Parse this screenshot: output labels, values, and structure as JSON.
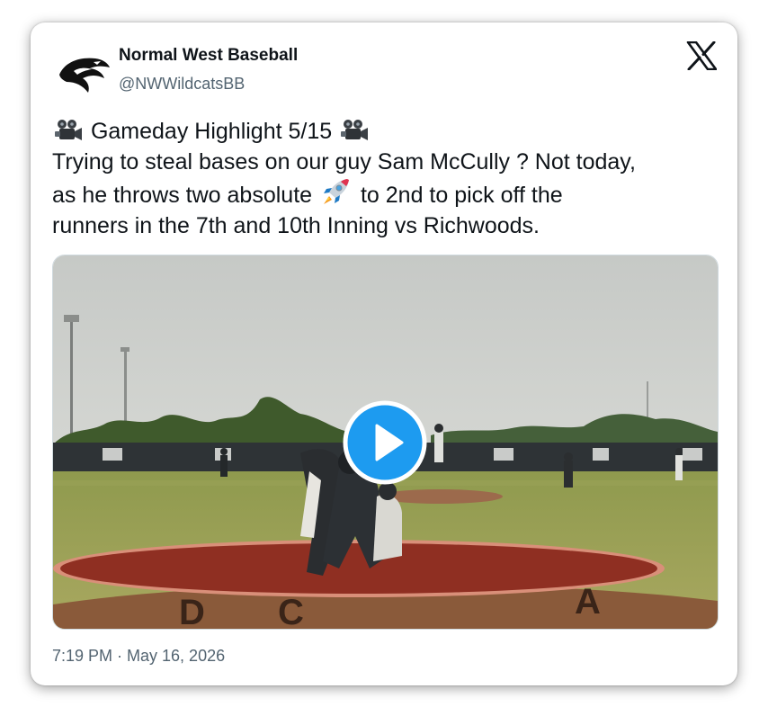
{
  "tweet": {
    "author_name": "Normal West Baseball",
    "author_handle": "@NWWildcatsBB",
    "text_lines": [
      "Gameday Highlight 5/15",
      "Trying to steal bases on our guy Sam McCully ? Not today,",
      "as he throws two absolute",
      "to 2nd to pick off the",
      "runners in the 7th and 10th Inning vs Richwoods."
    ],
    "timestamp": "7:19 PM · May 16, 2026"
  },
  "icons": {
    "avatar": "wildcat-logo-icon",
    "platform": "x-logo-icon",
    "camera_left": "movie-camera-icon",
    "camera_right": "movie-camera-icon",
    "rocket": "rocket-icon",
    "play": "play-icon"
  },
  "colors": {
    "text_primary": "#0f1419",
    "text_secondary": "#536471",
    "play_button": "#1d9bf0",
    "card_background": "#ffffff"
  }
}
